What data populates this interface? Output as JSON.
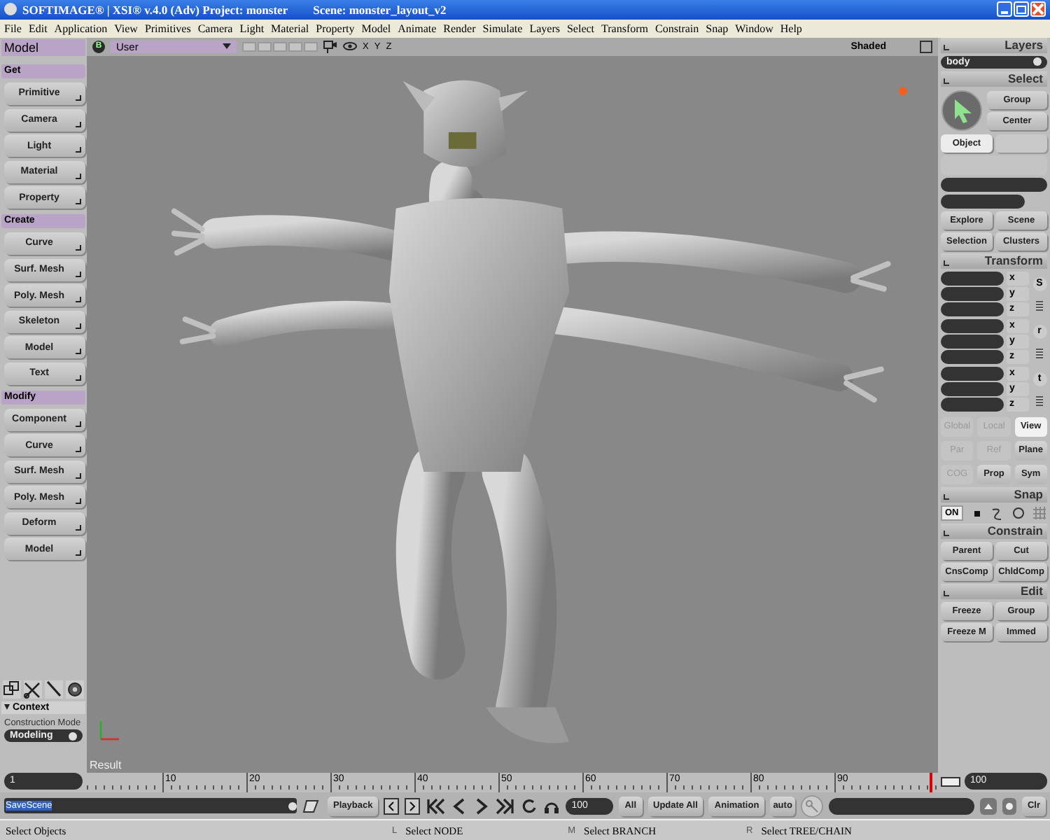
{
  "window": {
    "title": "SOFTIMAGE® | XSI® v.4.0 (Adv) Project: monster",
    "scene": "Scene: monster_layout_v2"
  },
  "menu": [
    "File",
    "Edit",
    "Application",
    "View",
    "Primitives",
    "Camera",
    "Light",
    "Material",
    "Property",
    "Model",
    "Animate",
    "Render",
    "Simulate",
    "Layers",
    "Select",
    "Transform",
    "Constrain",
    "Snap",
    "Window",
    "Help"
  ],
  "left_panel": {
    "title": "Model",
    "groups": [
      {
        "title": "Get",
        "buttons": [
          "Primitive",
          "Camera",
          "Light",
          "Material",
          "Property"
        ]
      },
      {
        "title": "Create",
        "buttons": [
          "Curve",
          "Surf. Mesh",
          "Poly. Mesh",
          "Skeleton",
          "Model",
          "Text"
        ]
      },
      {
        "title": "Modify",
        "buttons": [
          "Component",
          "Curve",
          "Surf. Mesh",
          "Poly. Mesh",
          "Deform",
          "Model"
        ]
      }
    ],
    "context": {
      "title": "Context",
      "label": "Construction Mode",
      "value": "Modeling"
    },
    "frame_start": "1"
  },
  "viewport": {
    "badge": "B",
    "camera": "User",
    "axes": [
      "X",
      "Y",
      "Z"
    ],
    "mode": "Shaded",
    "label": "Result"
  },
  "timeline": {
    "ticks": [
      "10",
      "20",
      "30",
      "40",
      "50",
      "60",
      "70",
      "80",
      "90"
    ]
  },
  "right_panel": {
    "title": "Layers",
    "layer": "body",
    "select": {
      "title": "Select",
      "buttons": [
        "Group",
        "Center"
      ],
      "modes": [
        {
          "label": "Object",
          "selected": true
        }
      ],
      "browse": [
        "Explore",
        "Scene",
        "Selection",
        "Clusters"
      ]
    },
    "transform": {
      "title": "Transform",
      "groups": [
        {
          "label": "S",
          "axes": [
            "x",
            "y",
            "z"
          ]
        },
        {
          "label": "r",
          "axes": [
            "x",
            "y",
            "z"
          ]
        },
        {
          "label": "t",
          "axes": [
            "x",
            "y",
            "z"
          ]
        }
      ],
      "options": [
        {
          "label": "Global",
          "selected": false,
          "disabled": true
        },
        {
          "label": "Local",
          "selected": false,
          "disabled": true
        },
        {
          "label": "View",
          "selected": true,
          "disabled": false
        },
        {
          "label": "Par",
          "selected": false,
          "disabled": true
        },
        {
          "label": "Ref",
          "selected": false,
          "disabled": true
        },
        {
          "label": "Plane",
          "selected": false,
          "disabled": false
        },
        {
          "label": "COG",
          "selected": false,
          "disabled": true
        },
        {
          "label": "Prop",
          "selected": false,
          "disabled": false
        },
        {
          "label": "Sym",
          "selected": false,
          "disabled": false
        }
      ]
    },
    "snap": {
      "title": "Snap",
      "toggle": "ON"
    },
    "constrain": {
      "title": "Constrain",
      "buttons": [
        "Parent",
        "Cut",
        "CnsComp",
        "ChldComp"
      ]
    },
    "edit": {
      "title": "Edit",
      "buttons": [
        "Freeze",
        "Group",
        "Freeze M",
        "Immed"
      ]
    },
    "frame_end": "100"
  },
  "command_bar": {
    "command": "SaveScene",
    "playback": "Playback",
    "end_frame": "100",
    "all": "All",
    "update": "Update All",
    "animation": "Animation",
    "auto": "auto",
    "clear": "Clr"
  },
  "status_bar": {
    "message": "Select Objects",
    "mouse": [
      {
        "button": "L",
        "action": "Select NODE"
      },
      {
        "button": "M",
        "action": "Select BRANCH"
      },
      {
        "button": "R",
        "action": "Select TREE/CHAIN"
      }
    ]
  }
}
